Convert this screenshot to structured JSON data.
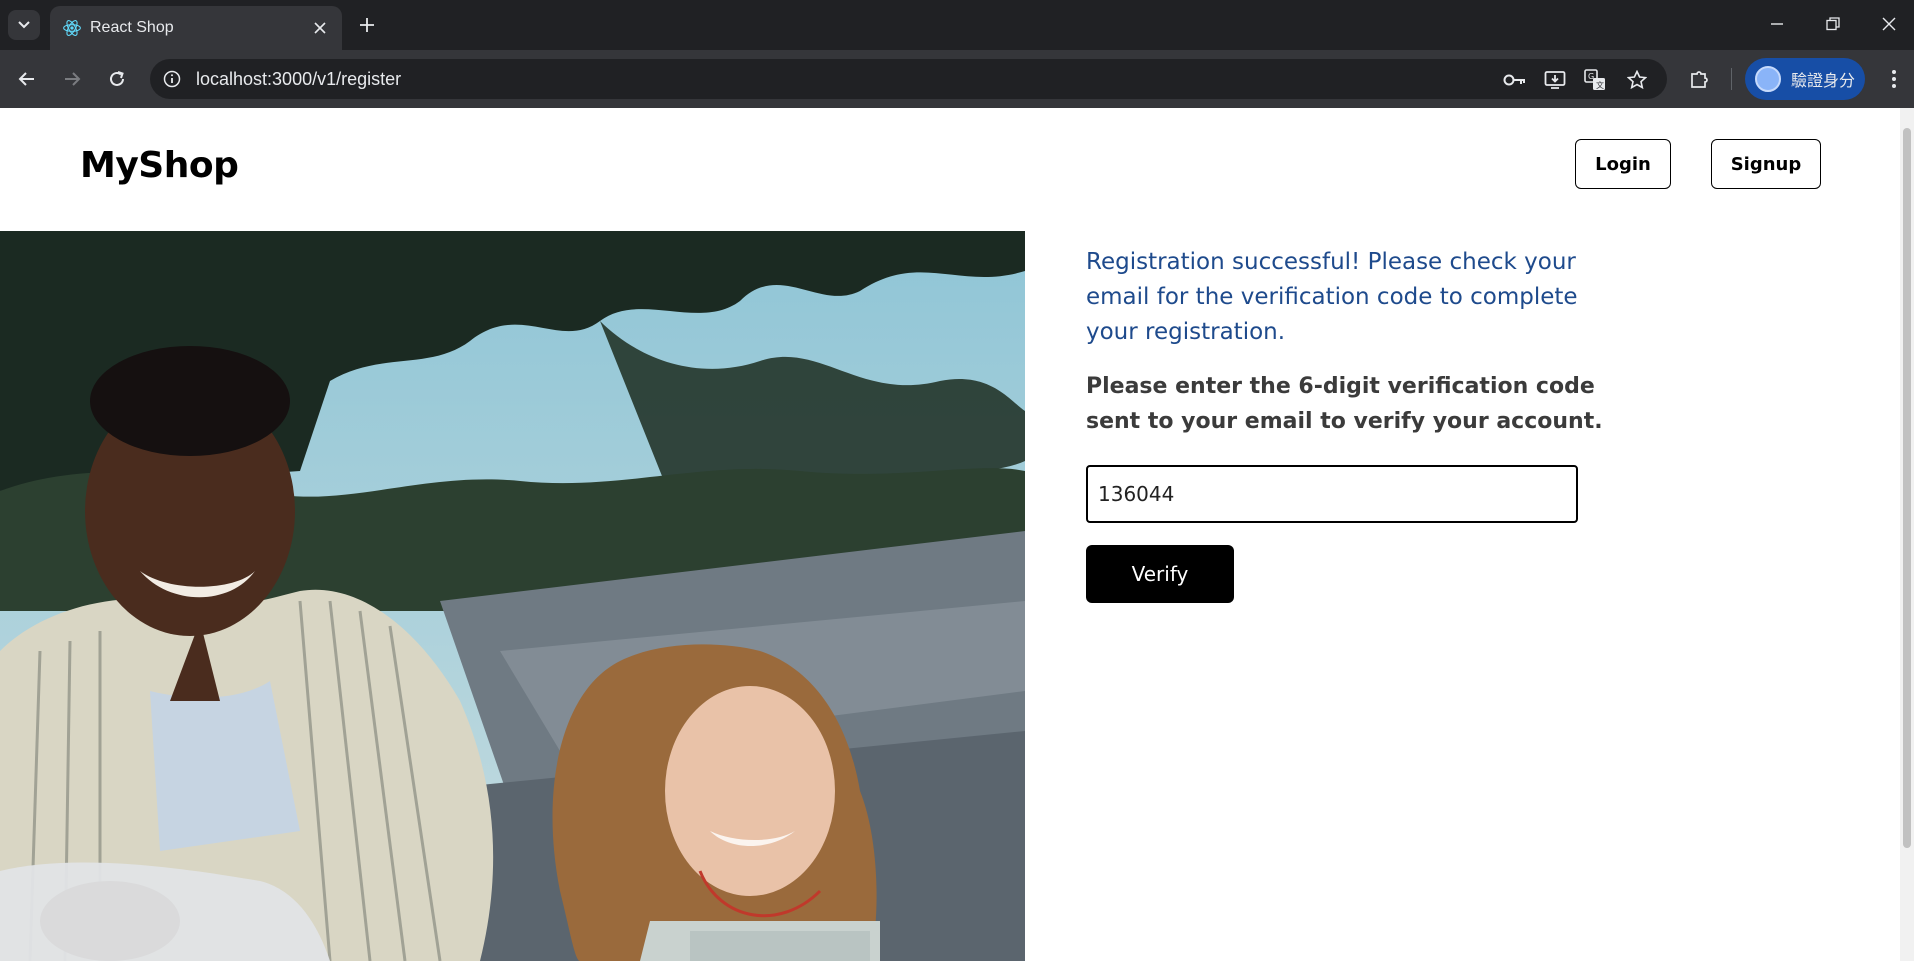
{
  "browser": {
    "tab_title": "React Shop",
    "url": "localhost:3000/v1/register",
    "profile_label": "驗證身分"
  },
  "header": {
    "brand": "MyShop",
    "login_label": "Login",
    "signup_label": "Signup"
  },
  "verification": {
    "success_message": "Registration successful! Please check your email for the verification code to complete your registration.",
    "instructions": "Please enter the 6-digit verification code sent to your email to verify your account.",
    "code_value": "136044",
    "verify_label": "Verify"
  },
  "colors": {
    "success_text": "#1e4a8c",
    "button_bg": "#000000",
    "chrome_dark": "#202124",
    "chrome_toolbar": "#35363a",
    "profile_chip": "#174ea6"
  },
  "icons": [
    "tab-search-icon",
    "react-favicon-icon",
    "close-icon",
    "plus-icon",
    "minimize-icon",
    "restore-icon",
    "window-close-icon",
    "back-icon",
    "forward-icon",
    "reload-icon",
    "info-icon",
    "password-key-icon",
    "install-app-icon",
    "translate-icon",
    "bookmark-star-icon",
    "extensions-icon",
    "avatar",
    "more-vert-icon"
  ]
}
